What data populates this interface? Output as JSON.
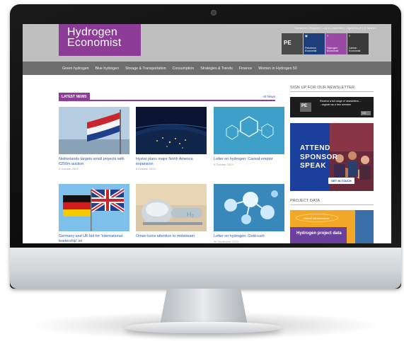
{
  "site": {
    "logo_line1": "Hydrogen",
    "logo_line2": "Economist",
    "utility_links": "Subscribe | Register | Log in | Advertise | Digital issue  |  Q Search",
    "publications": [
      {
        "mark": "",
        "label": "PE"
      },
      {
        "mark": "▣",
        "label": "Petroleum Economist"
      },
      {
        "mark": "≡",
        "label": "Hydrogen Economist"
      },
      {
        "mark": "≡",
        "label": "Carbon Economist"
      }
    ],
    "nav": [
      "Green hydrogen",
      "Blue hydrogen",
      "Storage & Transportation",
      "Consumption",
      "Strategies & Trends",
      "Finance",
      "Women in Hydrogen 50"
    ]
  },
  "latest_news": {
    "label": "LATEST NEWS",
    "all_link": "All News",
    "articles": [
      {
        "title": "Netherlands targets small projects with €250m auction",
        "date": "9 October 2023"
      },
      {
        "title": "Hystar plans major North America expansion",
        "date": "6 October 2023"
      },
      {
        "title": "Letter on hydrogen: Caveat emptor",
        "date": "5 October 2023"
      },
      {
        "title": "Germany and UK bid for 'international leadership' on",
        "date": ""
      },
      {
        "title": "Oman turns attention to midstream",
        "date": ""
      },
      {
        "title": "Letter on hydrogen: Gold rush",
        "date": "28 September 2023"
      }
    ]
  },
  "sidebar": {
    "newsletter_label": "SIGN UP FOR OUR NEWSLETTER",
    "newsletter_pe": "PE",
    "newsletter_text": "Receive a full range of newsletters.... ...register as a free member",
    "newsletter_go": "GO",
    "ad_lines": [
      "ATTEND",
      "SPONSOR",
      "SPEAK"
    ],
    "ad_button": "GET IN TOUCH",
    "project_data_label": "PROJECT DATA",
    "project_logo": "Global Infrastructure",
    "project_title": "Hydrogen project data"
  },
  "colors": {
    "brand": "#8c3b96",
    "link": "#2d5aa8",
    "header_gray": "#bfbfbf",
    "nav_gray": "#6e6e6e",
    "ad_blue": "#1a3f9c",
    "project_orange": "#f2a826"
  }
}
